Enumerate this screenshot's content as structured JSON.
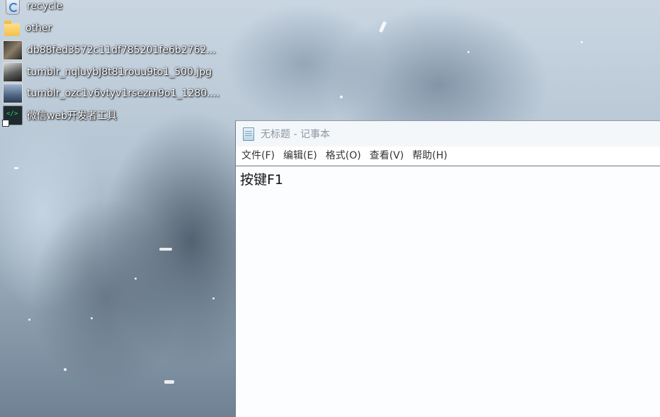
{
  "desktop": {
    "icons": [
      {
        "label": "recycle",
        "icon": "recycle-bin-icon"
      },
      {
        "label": "other",
        "icon": "folder-icon"
      },
      {
        "label": "db88fed3572c11df785201fe6b2762...",
        "icon": "image-file-icon"
      },
      {
        "label": "tumblr_nqluybJ8t81rouu9to1_500.jpg",
        "icon": "image-file-icon"
      },
      {
        "label": "tumblr_ozc1v6vtyv1rsezm9o1_1280....",
        "icon": "image-file-icon"
      },
      {
        "label": "微信web开发者工具",
        "icon": "wechat-devtools-icon"
      }
    ]
  },
  "notepad": {
    "title": "无标题 - 记事本",
    "menu": [
      {
        "label": "文件(F)"
      },
      {
        "label": "编辑(E)"
      },
      {
        "label": "格式(O)"
      },
      {
        "label": "查看(V)"
      },
      {
        "label": "帮助(H)"
      }
    ],
    "content": "按键F1"
  },
  "colors": {
    "title_text": "#8b97a3",
    "menu_text": "#333333",
    "editor_bg": "#fcfdff"
  }
}
